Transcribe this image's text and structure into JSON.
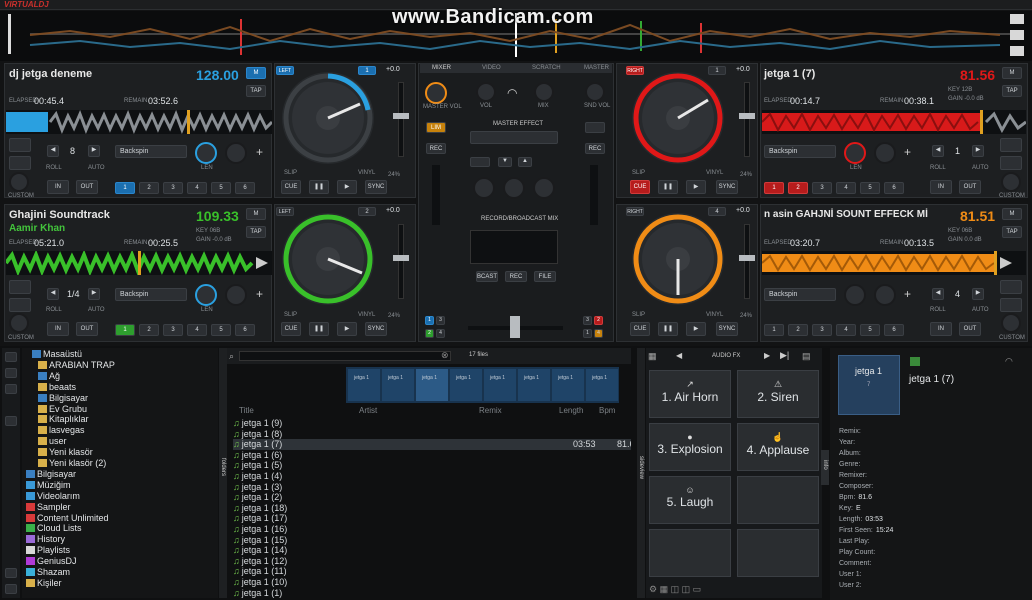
{
  "app": {
    "logo": "VIRTUALDJ",
    "watermark": "www.Bandicam.com"
  },
  "colors": {
    "blue": "#2aa0e0",
    "red": "#e01818",
    "green": "#39c02a",
    "orange": "#f08c16"
  },
  "decks": {
    "d1": {
      "side": "LEFT",
      "num": "1",
      "title": "dj jetga deneme",
      "artist": "",
      "bpm": "128.00",
      "elapsed_label": "ELAPSED",
      "elapsed": "00:45.4",
      "remain_label": "REMAIN",
      "remain": "03:52.6",
      "key": "",
      "gain": "",
      "loop": "8",
      "effect": "Backspin",
      "pitch": "+0.0",
      "btn_in": "IN",
      "btn_out": "OUT",
      "btn_cue": "CUE",
      "btn_sync": "SYNC",
      "btn_tap": "TAP",
      "btn_m": "M",
      "custom": "CUSTOM",
      "len": "LEN",
      "roll": "ROLL",
      "auto": "AUTO",
      "slip": "SLIP",
      "vinyl": "VINYL",
      "pct": "24%"
    },
    "d2": {
      "side": "RIGHT",
      "num": "1",
      "title": "jetga 1 (7)",
      "artist": "",
      "bpm": "81.56",
      "elapsed_label": "ELAPSED",
      "elapsed": "00:14.7",
      "remain_label": "REMAIN",
      "remain": "00:38.1",
      "key": "KEY 12B",
      "gain": "GAIN -0.0 dB",
      "loop": "1",
      "effect": "Backspin",
      "pitch": "+0.0",
      "btn_in": "IN",
      "btn_out": "OUT",
      "btn_cue": "CUE",
      "btn_sync": "SYNC",
      "btn_tap": "TAP",
      "btn_m": "M",
      "custom": "CUSTOM",
      "len": "LEN",
      "roll": "ROLL",
      "auto": "AUTO",
      "slip": "SLIP",
      "vinyl": "VINYL",
      "pct": "24%"
    },
    "d3": {
      "side": "LEFT",
      "num": "2",
      "title": "Ghajini Soundtrack",
      "artist": "Aamir Khan",
      "bpm": "109.33",
      "elapsed_label": "ELAPSED",
      "elapsed": "05:21.0",
      "remain_label": "REMAIN",
      "remain": "00:25.5",
      "key": "KEY 06B",
      "gain": "GAIN -0.0 dB",
      "loop": "1/4",
      "effect": "Backspin",
      "pitch": "+0.0",
      "btn_in": "IN",
      "btn_out": "OUT",
      "btn_cue": "CUE",
      "btn_sync": "SYNC",
      "btn_tap": "TAP",
      "btn_m": "M",
      "custom": "CUSTOM",
      "len": "LEN",
      "roll": "ROLL",
      "auto": "AUTO",
      "slip": "SLIP",
      "vinyl": "VINYL",
      "pct": "24%"
    },
    "d4": {
      "side": "RIGHT",
      "num": "4",
      "title": "n asin GAHJNİ SOUNT EFFECK Mİ",
      "artist": "",
      "bpm": "81.51",
      "elapsed_label": "ELAPSED",
      "elapsed": "03:20.7",
      "remain_label": "REMAIN",
      "remain": "00:13.5",
      "key": "KEY 06B",
      "gain": "GAIN 0.0 dB",
      "loop": "4",
      "effect": "Backspin",
      "pitch": "+0.0",
      "btn_in": "IN",
      "btn_out": "OUT",
      "btn_cue": "CUE",
      "btn_sync": "SYNC",
      "btn_tap": "TAP",
      "btn_m": "M",
      "custom": "CUSTOM",
      "len": "LEN",
      "roll": "ROLL",
      "auto": "AUTO",
      "slip": "SLIP",
      "vinyl": "VINYL",
      "pct": "24%"
    }
  },
  "mixer": {
    "tabs": [
      "MIXER",
      "VIDEO",
      "SCRATCH",
      "MASTER"
    ],
    "master_vol": "MASTER VOL",
    "snd_vol": "SND VOL",
    "vol": "VOL",
    "mix": "MIX",
    "master_effect": "MASTER EFFECT",
    "record_broadcast": "RECORD/BROADCAST MIX",
    "bcast": "BCAST",
    "rec": "REC",
    "file": "FILE",
    "lim": "LIM",
    "rec_small": "REC",
    "cue_label": "CUE"
  },
  "browser": {
    "file_count": "17 files",
    "tree": [
      "Masaüstü",
      "ARABIAN TRAP",
      "Ağ",
      "beaats",
      "Bilgisayar",
      "Ev Grubu",
      "Kitaplıklar",
      "lasvegas",
      "user",
      "Yeni klasör",
      "Yeni klasör (2)",
      "Bilgisayar",
      "Müziğim",
      "Videolarım",
      "Sampler",
      "Content Unlimited",
      "Cloud Lists",
      "History",
      "Playlists",
      "GeniusDJ",
      "Shazam",
      "Kişiler"
    ],
    "columns": {
      "title": "Title",
      "artist": "Artist",
      "remix": "Remix",
      "length": "Length",
      "bpm": "Bpm"
    },
    "songs": [
      "jetga 1 (9)",
      "jetga 1 (8)",
      "jetga 1 (7)",
      "jetga 1 (6)",
      "jetga 1 (5)",
      "jetga 1 (4)",
      "jetga 1 (3)",
      "jetga 1 (2)",
      "jetga 1 (18)",
      "jetga 1 (17)",
      "jetga 1 (16)",
      "jetga 1 (15)",
      "jetga 1 (14)",
      "jetga 1 (12)",
      "jetga 1 (11)",
      "jetga 1 (10)",
      "jetga 1 (1)"
    ],
    "selected": {
      "length": "03:53",
      "bpm": "81.6"
    },
    "thumb_labels": [
      "jetga 1",
      "jetga 1",
      "jetga 1",
      "jetga 1",
      "jetga 1",
      "jetga 1",
      "jetga 1",
      "jetga 1"
    ],
    "folders_tab": "folders",
    "sideview_tab": "sideview",
    "info_tab": "info"
  },
  "sampler": {
    "title": "AUDIO FX",
    "pads": [
      "1. Air Horn",
      "2. Siren",
      "3. Explosion",
      "4. Applause",
      "5. Laugh"
    ]
  },
  "info": {
    "card_title": "jetga 1",
    "card_num": "7",
    "name": "jetga 1 (7)",
    "rows": [
      [
        "Remix:",
        ""
      ],
      [
        "Year:",
        ""
      ],
      [
        "Album:",
        ""
      ],
      [
        "Genre:",
        ""
      ],
      [
        "Remixer:",
        ""
      ],
      [
        "Composer:",
        ""
      ],
      [
        "Bpm:",
        "81.6"
      ],
      [
        "Key:",
        "E"
      ],
      [
        "Length:",
        "03:53"
      ],
      [
        "First Seen:",
        "15:24"
      ],
      [
        "Last Play:",
        ""
      ],
      [
        "Play Count:",
        ""
      ],
      [
        "Comment:",
        ""
      ],
      [
        "User 1:",
        ""
      ],
      [
        "User 2:",
        ""
      ]
    ]
  }
}
